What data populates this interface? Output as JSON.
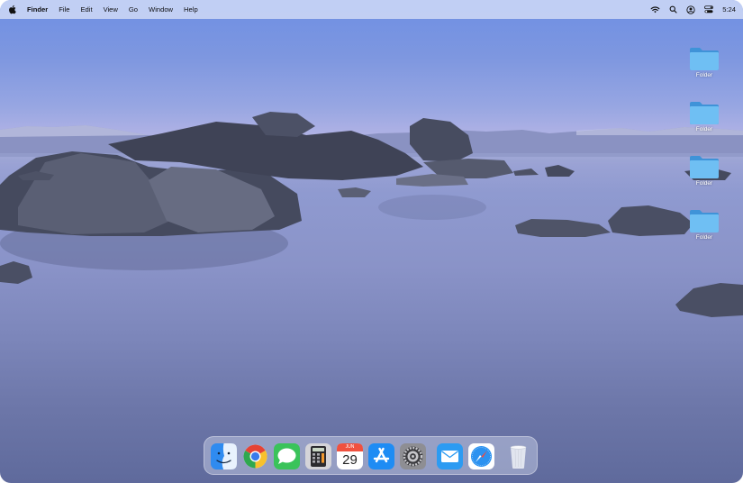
{
  "menubar": {
    "apple_icon": "apple-icon",
    "items": [
      "Finder",
      "File",
      "Edit",
      "View",
      "Go",
      "Window",
      "Help"
    ],
    "status_icons": [
      "wifi-icon",
      "search-icon",
      "user-account-icon",
      "control-center-icon"
    ],
    "clock": "5:24"
  },
  "desktop": {
    "folders": [
      {
        "label": "Folder",
        "icon": "folder-icon"
      },
      {
        "label": "Folder",
        "icon": "folder-icon"
      },
      {
        "label": "Folder",
        "icon": "folder-icon"
      },
      {
        "label": "Folder",
        "icon": "folder-icon"
      }
    ],
    "folder_color": "#5ab0ef"
  },
  "dock": {
    "apps": [
      {
        "name": "Finder",
        "icon": "finder-icon"
      },
      {
        "name": "Chrome",
        "icon": "chrome-icon"
      },
      {
        "name": "Messages",
        "icon": "messages-icon"
      },
      {
        "name": "Calculator",
        "icon": "calculator-icon"
      },
      {
        "name": "Calendar",
        "icon": "calendar-icon",
        "month": "JUN",
        "day": "29"
      },
      {
        "name": "App Store",
        "icon": "app-store-icon"
      },
      {
        "name": "System Settings",
        "icon": "settings-icon"
      },
      {
        "name": "Mail",
        "icon": "mail-icon"
      },
      {
        "name": "Safari",
        "icon": "safari-icon"
      },
      {
        "name": "Trash",
        "icon": "trash-icon"
      }
    ]
  },
  "colors": {
    "sky_top": "#6e8fe3",
    "horizon": "#b4b4e2",
    "water": "#7c86ba",
    "rock": "#4a4e5e"
  }
}
